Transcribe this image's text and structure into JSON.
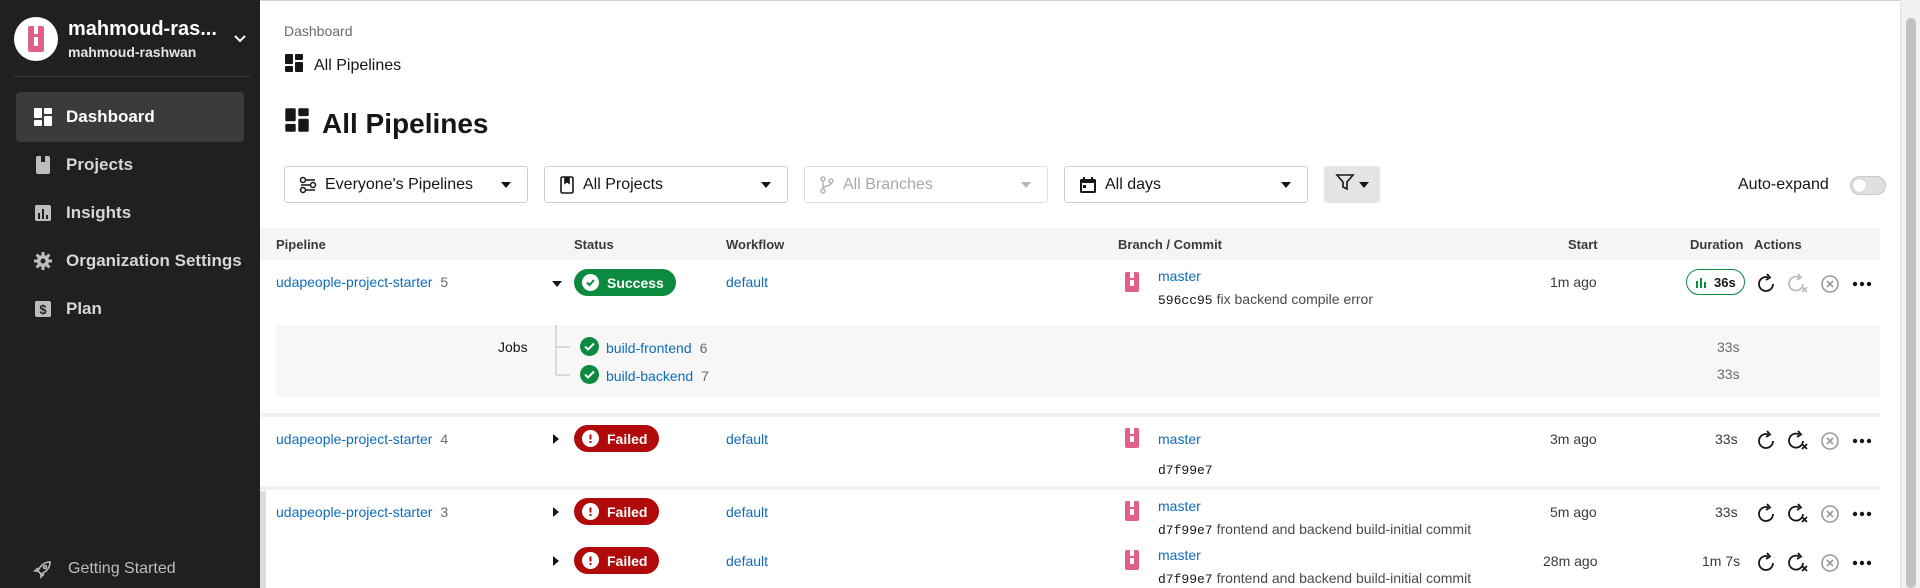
{
  "org": {
    "name": "mahmoud-ras...",
    "username": "mahmoud-rashwan"
  },
  "nav": {
    "items": [
      {
        "label": "Dashboard",
        "icon": "dashboard-icon",
        "active": true
      },
      {
        "label": "Projects",
        "icon": "projects-icon"
      },
      {
        "label": "Insights",
        "icon": "insights-icon"
      },
      {
        "label": "Organization Settings",
        "icon": "gear-icon"
      },
      {
        "label": "Plan",
        "icon": "dollar-icon"
      }
    ],
    "getting_started": "Getting Started"
  },
  "breadcrumb": {
    "root": "Dashboard",
    "page": "All Pipelines"
  },
  "page_title": "All Pipelines",
  "filters": {
    "pipelines": "Everyone's Pipelines",
    "projects": "All Projects",
    "branches": "All Branches",
    "days": "All days",
    "auto_expand_label": "Auto-expand"
  },
  "table": {
    "headers": {
      "pipeline": "Pipeline",
      "status": "Status",
      "workflow": "Workflow",
      "branch_commit": "Branch / Commit",
      "start": "Start",
      "duration": "Duration",
      "actions": "Actions"
    },
    "rows": [
      {
        "pipeline": "udapeople-project-starter",
        "number": "5",
        "status": "Success",
        "workflow": "default",
        "branch": "master",
        "commit_hash": "596cc95",
        "commit_msg": "fix backend compile error",
        "start": "1m ago",
        "duration": "36s",
        "jobs_label": "Jobs",
        "jobs": [
          {
            "name": "build-frontend",
            "number": "6",
            "duration": "33s"
          },
          {
            "name": "build-backend",
            "number": "7",
            "duration": "33s"
          }
        ]
      },
      {
        "pipeline": "udapeople-project-starter",
        "number": "4",
        "status": "Failed",
        "workflow": "default",
        "branch": "master",
        "commit_hash": "d7f99e7",
        "commit_msg": "",
        "start": "3m ago",
        "duration": "33s"
      },
      {
        "pipeline": "udapeople-project-starter",
        "number": "3",
        "status": "Failed",
        "workflow": "default",
        "branch": "master",
        "commit_hash": "d7f99e7",
        "commit_msg": "frontend and backend build-initial commit",
        "start": "5m ago",
        "duration": "33s"
      },
      {
        "status": "Failed",
        "workflow": "default",
        "branch": "master",
        "commit_hash": "d7f99e7",
        "commit_msg": "frontend and backend build-initial commit",
        "start": "28m ago",
        "duration": "1m 7s"
      }
    ]
  },
  "colors": {
    "success": "#0c8a3f",
    "failed": "#b00a0a",
    "link": "#0f6cbd",
    "sidebar": "#202020"
  }
}
